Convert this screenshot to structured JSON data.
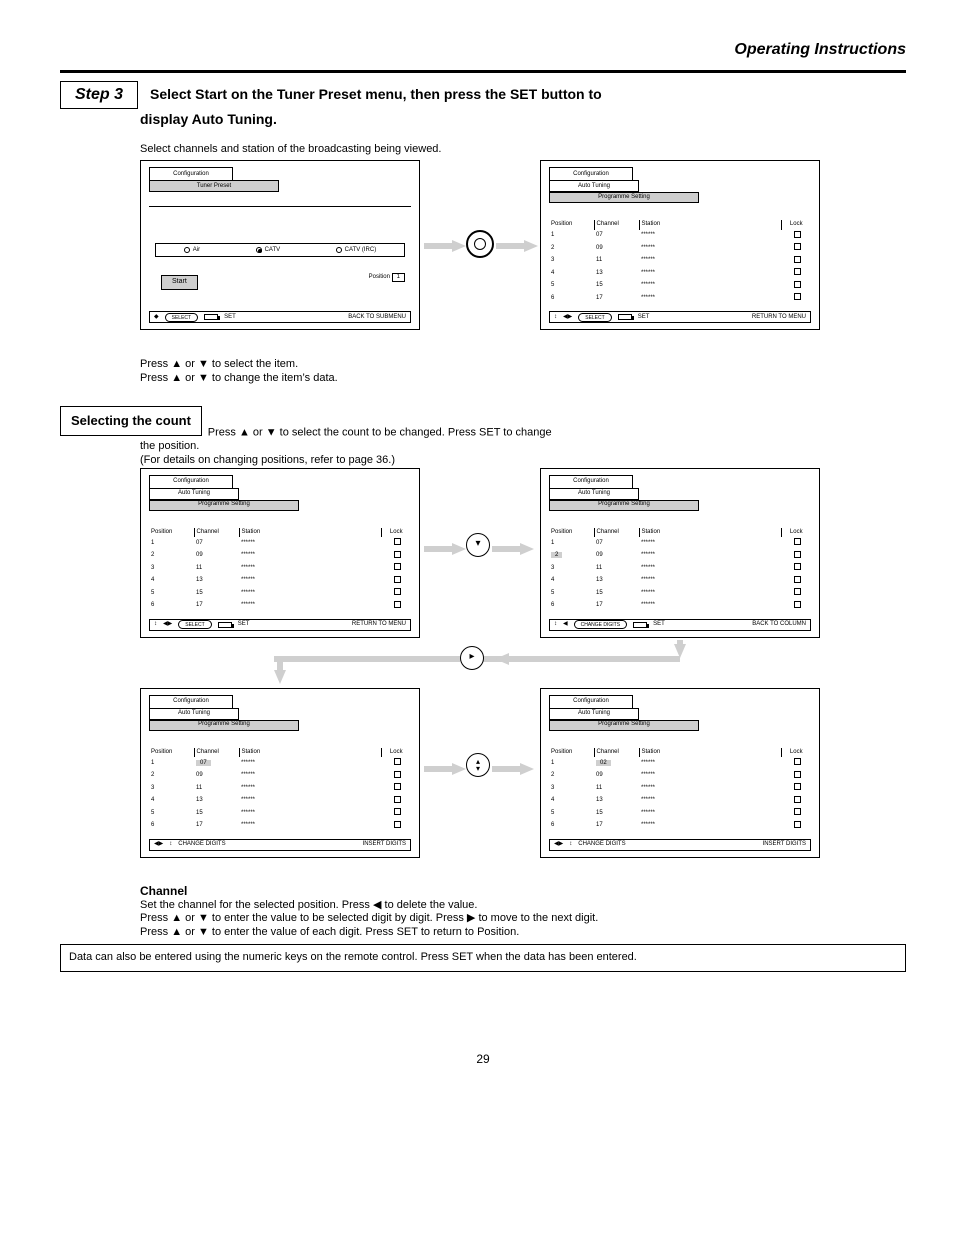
{
  "header": {
    "page_title": "Operating Instructions"
  },
  "step": {
    "label": "Step 3",
    "headline": "Select Start on the Tuner Preset menu, then press the SET button to",
    "headline2": "display Auto Tuning."
  },
  "intro": {
    "line": "Select channels and station of the broadcasting being viewed."
  },
  "panels_a": {
    "left": {
      "tab1": "Configuration",
      "tab1_sub": "Tuner Preset",
      "radio_air": "Air",
      "radio_catv": "CATV",
      "radio_catv_irc": "CATV (IRC)",
      "start": "Start",
      "position_lbl": "Position",
      "position_val": "1",
      "foot_icon": "◆",
      "foot_select": "SELECT",
      "foot_set": "SET",
      "foot_menu": "BACK TO SUBMENU"
    },
    "right": {
      "tab1": "Configuration",
      "tab1_sub": "Auto Tuning",
      "sub2": "Programme Setting",
      "cols": [
        "Position",
        "Channel",
        "Station",
        "Lock"
      ],
      "foot_arrows": "↕",
      "foot_lr": "◀▶",
      "foot_select": "SELECT",
      "foot_set": "SET",
      "foot_menu": "RETURN TO MENU"
    }
  },
  "explainA": {
    "l1a": "Press ",
    "l1b": " or ",
    "l1c": " to select the item.",
    "l2a": "Press ",
    "l2b": " or ",
    "l2c": " to change the item’s data."
  },
  "selcount": {
    "title": "Selecting the count",
    "desc_a": "Press ",
    "desc_b": " or ",
    "desc_c": " to select the count to be changed. Press SET to change",
    "desc2": "the position.",
    "note": "(For details on changing positions, refer to page 36.)"
  },
  "panels_b": {
    "p1": {
      "tab1": "Configuration",
      "tab1_sub": "Auto Tuning",
      "sub2": "Programme Setting",
      "foot_arrows": "↕",
      "foot_lr": "◀▶",
      "foot_select": "SELECT",
      "foot_set": "SET",
      "foot_menu": "RETURN TO MENU"
    },
    "p2": {
      "tab1": "Configuration",
      "tab1_sub": "Auto Tuning",
      "sub2": "Programme Setting",
      "hl": "2",
      "foot_arrows": "↕",
      "foot_tri": "◀",
      "foot_change": "CHANGE DIGITS",
      "foot_set": "SET",
      "foot_back": "BACK TO COLUMN"
    },
    "p3": {
      "tab1": "Configuration",
      "tab1_sub": "Auto Tuning",
      "sub2": "Programme Setting",
      "hl": "07",
      "foot_lr": "◀▶",
      "foot_updown": "↕",
      "foot_change": "CHANGE DIGITS",
      "foot_insert": "INSERT DIGITS"
    },
    "p4": {
      "tab1": "Configuration",
      "tab1_sub": "Auto Tuning",
      "sub2": "Programme Setting",
      "hl": "02",
      "foot_lr": "◀▶",
      "foot_updown": "↕",
      "foot_change": "CHANGE DIGITS",
      "foot_insert": "INSERT DIGITS"
    }
  },
  "deck": {
    "rows": [
      {
        "pos": "1",
        "ch": "07",
        "st": "******",
        "lock": true
      },
      {
        "pos": "2",
        "ch": "09",
        "st": "******",
        "lock": true
      },
      {
        "pos": "3",
        "ch": "11",
        "st": "******",
        "lock": true
      },
      {
        "pos": "4",
        "ch": "13",
        "st": "******",
        "lock": true
      },
      {
        "pos": "5",
        "ch": "15",
        "st": "******",
        "lock": true
      },
      {
        "pos": "6",
        "ch": "17",
        "st": "******",
        "lock": true
      }
    ]
  },
  "channel": {
    "heading": "Channel",
    "line1_a": "Set the channel for the selected position. Press ",
    "line1_b": " to delete the value.",
    "line2_a": "Press ",
    "line2_b": " or ",
    "line2_c": " to enter the value to be selected digit by digit. Press ",
    "line2_d": " to move to the next digit.",
    "line3_a": "Press ",
    "line3_b": " or ",
    "line3_c": " to enter the value of each digit. Press SET to return to Position.",
    "boxline": "Data can also be entered using the numeric keys on the remote control. Press SET when the data has been entered."
  },
  "page_number": "29"
}
